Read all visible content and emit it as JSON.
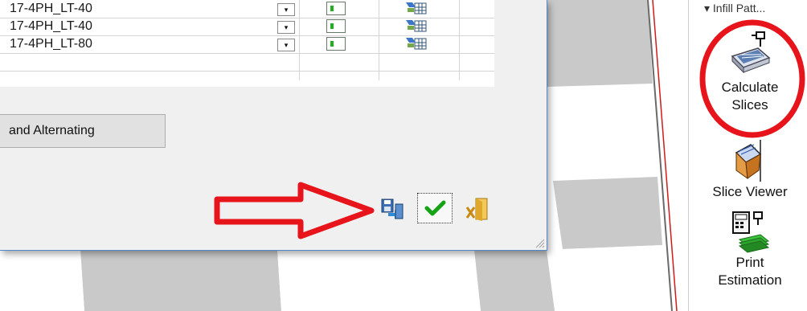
{
  "material_table": {
    "rows": [
      {
        "name": "17-4PH_LT-40",
        "combo_glyph": "▾"
      },
      {
        "name": "17-4PH_LT-40",
        "combo_glyph": "▾"
      },
      {
        "name": "17-4PH_LT-80",
        "combo_glyph": "▾"
      }
    ]
  },
  "dialog": {
    "mode_button_label": "and Alternating",
    "footer_icons": {
      "save": "save-apply-icon",
      "ok": "green-check-icon",
      "cancel": "cancel-exit-icon"
    }
  },
  "ribbon": {
    "group_label": "▾ Infill Patt...",
    "items": [
      {
        "label_line1": "Calculate",
        "label_line2": "Slices",
        "icon": "calculate-slices-icon"
      },
      {
        "label_line1": "Slice Viewer",
        "label_line2": "",
        "icon": "slice-viewer-icon"
      },
      {
        "label_line1": "Print",
        "label_line2": "Estimation",
        "icon": "print-estimation-icon"
      }
    ]
  },
  "colors": {
    "dialog_bg": "#f0f0f0",
    "dialog_border": "#4f87c8",
    "annotation_red": "#e8141b",
    "checker_gray": "#c9c9c9",
    "ok_green": "#16a316"
  }
}
